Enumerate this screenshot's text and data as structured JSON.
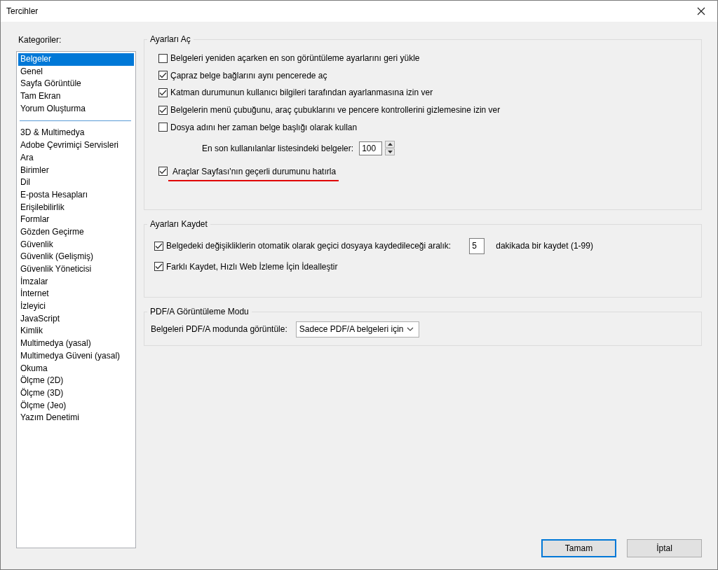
{
  "window": {
    "title": "Tercihler"
  },
  "categories": {
    "label": "Kategoriler:",
    "items": [
      {
        "kind": "item",
        "label": "Belgeler",
        "selected": true
      },
      {
        "kind": "item",
        "label": "Genel",
        "selected": false
      },
      {
        "kind": "item",
        "label": "Sayfa Görüntüle",
        "selected": false
      },
      {
        "kind": "item",
        "label": "Tam Ekran",
        "selected": false
      },
      {
        "kind": "item",
        "label": "Yorum Oluşturma",
        "selected": false
      },
      {
        "kind": "separator"
      },
      {
        "kind": "item",
        "label": "3D & Multimedya",
        "selected": false
      },
      {
        "kind": "item",
        "label": "Adobe Çevrimiçi Servisleri",
        "selected": false
      },
      {
        "kind": "item",
        "label": "Ara",
        "selected": false
      },
      {
        "kind": "item",
        "label": "Birimler",
        "selected": false
      },
      {
        "kind": "item",
        "label": "Dil",
        "selected": false
      },
      {
        "kind": "item",
        "label": "E-posta Hesapları",
        "selected": false
      },
      {
        "kind": "item",
        "label": "Erişilebilirlik",
        "selected": false
      },
      {
        "kind": "item",
        "label": "Formlar",
        "selected": false
      },
      {
        "kind": "item",
        "label": "Gözden Geçirme",
        "selected": false
      },
      {
        "kind": "item",
        "label": "Güvenlik",
        "selected": false
      },
      {
        "kind": "item",
        "label": "Güvenlik (Gelişmiş)",
        "selected": false
      },
      {
        "kind": "item",
        "label": "Güvenlik Yöneticisi",
        "selected": false
      },
      {
        "kind": "item",
        "label": "İmzalar",
        "selected": false
      },
      {
        "kind": "item",
        "label": "İnternet",
        "selected": false
      },
      {
        "kind": "item",
        "label": "İzleyici",
        "selected": false
      },
      {
        "kind": "item",
        "label": "JavaScript",
        "selected": false
      },
      {
        "kind": "item",
        "label": "Kimlik",
        "selected": false
      },
      {
        "kind": "item",
        "label": "Multimedya (yasal)",
        "selected": false
      },
      {
        "kind": "item",
        "label": "Multimedya Güveni (yasal)",
        "selected": false
      },
      {
        "kind": "item",
        "label": "Okuma",
        "selected": false
      },
      {
        "kind": "item",
        "label": "Ölçme (2D)",
        "selected": false
      },
      {
        "kind": "item",
        "label": "Ölçme (3D)",
        "selected": false
      },
      {
        "kind": "item",
        "label": "Ölçme (Jeo)",
        "selected": false
      },
      {
        "kind": "item",
        "label": "Yazım Denetimi",
        "selected": false
      }
    ]
  },
  "sections": [
    {
      "title": "Ayarları Aç",
      "rows": [
        {
          "kind": "checkbox",
          "label": "Belgeleri yeniden açarken en son görüntüleme ayarlarını geri yükle",
          "checked": false,
          "underlined": false
        },
        {
          "kind": "checkbox",
          "label": "Çapraz belge bağlarını aynı pencerede aç",
          "checked": true,
          "underlined": false
        },
        {
          "kind": "checkbox",
          "label": "Katman durumunun kullanıcı bilgileri tarafından ayarlanmasına izin ver",
          "checked": true,
          "underlined": false
        },
        {
          "kind": "checkbox",
          "label": "Belgelerin menü çubuğunu, araç çubuklarını ve pencere kontrollerini gizlemesine izin ver",
          "checked": true,
          "underlined": false
        },
        {
          "kind": "checkbox",
          "label": "Dosya adını her zaman belge başlığı olarak kullan",
          "checked": false,
          "underlined": false
        },
        {
          "kind": "spinner",
          "label": "En son kullanılanlar listesindeki belgeler:",
          "value": "100"
        },
        {
          "kind": "checkbox",
          "label": "Araçlar Sayfası'nın geçerli durumunu hatırla",
          "checked": true,
          "underlined": true
        }
      ]
    },
    {
      "title": "Ayarları Kaydet",
      "rows": [
        {
          "kind": "checkbox_field",
          "label": "Belgedeki değişikliklerin otomatik olarak geçici dosyaya kaydedileceği aralık:",
          "checked": true,
          "value": "5",
          "suffix": "dakikada bir kaydet (1-99)"
        },
        {
          "kind": "checkbox",
          "label": "Farklı Kaydet, Hızlı Web İzleme İçin İdealleştir",
          "checked": true,
          "underlined": false
        }
      ]
    },
    {
      "title": "PDF/A Görüntüleme Modu",
      "rows": [
        {
          "kind": "dropdown",
          "label": "Belgeleri PDF/A modunda görüntüle:",
          "value": "Sadece PDF/A belgeleri için"
        }
      ]
    }
  ],
  "buttons": [
    {
      "label": "Tamam",
      "default": true
    },
    {
      "label": "İptal",
      "default": false
    }
  ]
}
